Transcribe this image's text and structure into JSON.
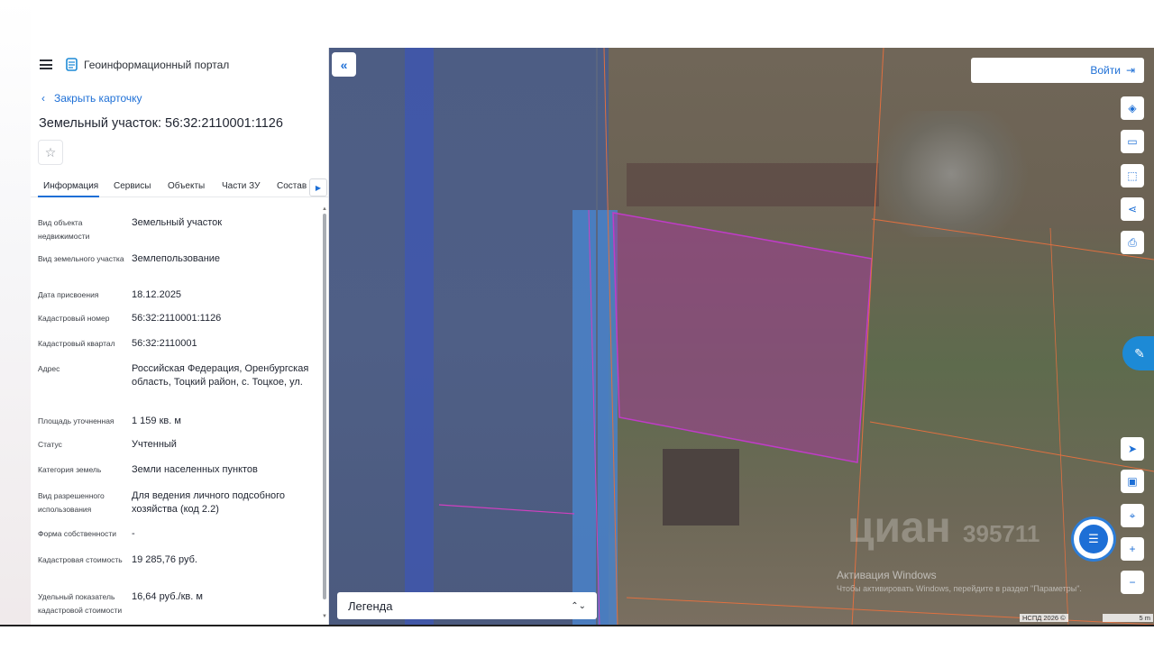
{
  "header": {
    "portal_title": "Геоинформационный портал"
  },
  "card": {
    "close_label": "Закрыть карточку",
    "title": "Земельный участок: 56:32:2110001:1126",
    "favorite_icon": "star-outline-icon"
  },
  "tabs": [
    {
      "label": "Информация",
      "active": true
    },
    {
      "label": "Сервисы",
      "active": false
    },
    {
      "label": "Объекты",
      "active": false
    },
    {
      "label": "Части ЗУ",
      "active": false
    },
    {
      "label": "Состав",
      "active": false
    }
  ],
  "info": [
    {
      "label": "Вид объекта недвижимости",
      "value": "Земельный участок"
    },
    {
      "label": "Вид земельного участка",
      "value": "Землепользование"
    },
    {
      "label": "Дата присвоения",
      "value": "18.12.2025"
    },
    {
      "label": "Кадастровый номер",
      "value": "56:32:2110001:1126"
    },
    {
      "label": "Кадастровый квартал",
      "value": "56:32:2110001"
    },
    {
      "label": "Адрес",
      "value": "Российская Федерация, Оренбургская область, Тоцкий район, с. Тоцкое, ул."
    },
    {
      "label": "Площадь уточненная",
      "value": "1 159 кв. м"
    },
    {
      "label": "Статус",
      "value": "Учтенный"
    },
    {
      "label": "Категория земель",
      "value": "Земли населенных пунктов"
    },
    {
      "label": "Вид разрешенного использования",
      "value": "Для ведения личного подсобного хозяйства (код 2.2)"
    },
    {
      "label": "Форма собственности",
      "value": "-"
    },
    {
      "label": "Кадастровая стоимость",
      "value": "19 285,76 руб."
    },
    {
      "label": "Удельный показатель кадастровой стоимости",
      "value": "16,64 руб./кв. м"
    }
  ],
  "map": {
    "login_label": "Войти",
    "legend_label": "Легенда",
    "watermark": "циан",
    "watermark_number": "395711",
    "windows_activation_title": "Активация Windows",
    "windows_activation_text": "Чтобы активировать Windows, перейдите в раздел \"Параметры\".",
    "attribution": "НСПД 2026 ©",
    "scale_label": "5 m",
    "tools": [
      "layers-icon",
      "ruler-icon",
      "select-area-icon",
      "share-icon",
      "print-icon",
      "locate-icon",
      "minimap-icon",
      "geo-pin-icon",
      "zoom-in-icon",
      "zoom-out-icon"
    ],
    "colors": {
      "accent": "#1d6fd6",
      "parcel": "#c03cc8"
    }
  }
}
